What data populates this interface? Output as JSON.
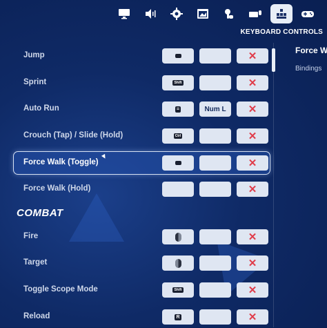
{
  "header": {
    "tabs": [
      {
        "icon": "monitor-icon"
      },
      {
        "icon": "speaker-icon"
      },
      {
        "icon": "gear-icon"
      },
      {
        "icon": "display-settings-icon"
      },
      {
        "icon": "touch-icon"
      },
      {
        "icon": "keyboard-mouse-icon"
      },
      {
        "icon": "keyboard-controls-icon",
        "active": true
      },
      {
        "icon": "gamepad-icon"
      }
    ],
    "section_title": "KEYBOARD CONTROLS"
  },
  "detail": {
    "title": "Force W",
    "subtitle": "Bindings"
  },
  "rows": [
    {
      "label": "Jump",
      "key1": "",
      "key1_icon": "keycap-glyph",
      "key2": ""
    },
    {
      "label": "Sprint",
      "key1": "Shift",
      "key2": ""
    },
    {
      "label": "Auto Run",
      "key1": "=",
      "key2": "Num L"
    },
    {
      "label": "Crouch (Tap) / Slide (Hold)",
      "key1": "Ctrl",
      "key2": ""
    },
    {
      "label": "Force Walk (Toggle)",
      "key1": "",
      "key1_icon": "keycap-glyph",
      "key2": "",
      "selected": true
    },
    {
      "label": "Force Walk (Hold)",
      "key1": "",
      "key2": ""
    }
  ],
  "combat_heading": "COMBAT",
  "combat_rows": [
    {
      "label": "Fire",
      "key1_icon": "mouse-left-icon",
      "key2": ""
    },
    {
      "label": "Target",
      "key1_icon": "mouse-right-icon",
      "key2": ""
    },
    {
      "label": "Toggle Scope Mode",
      "key1": "Shift",
      "key2": ""
    },
    {
      "label": "Reload",
      "key1": "R",
      "key2": ""
    }
  ],
  "clear_label": "✕"
}
